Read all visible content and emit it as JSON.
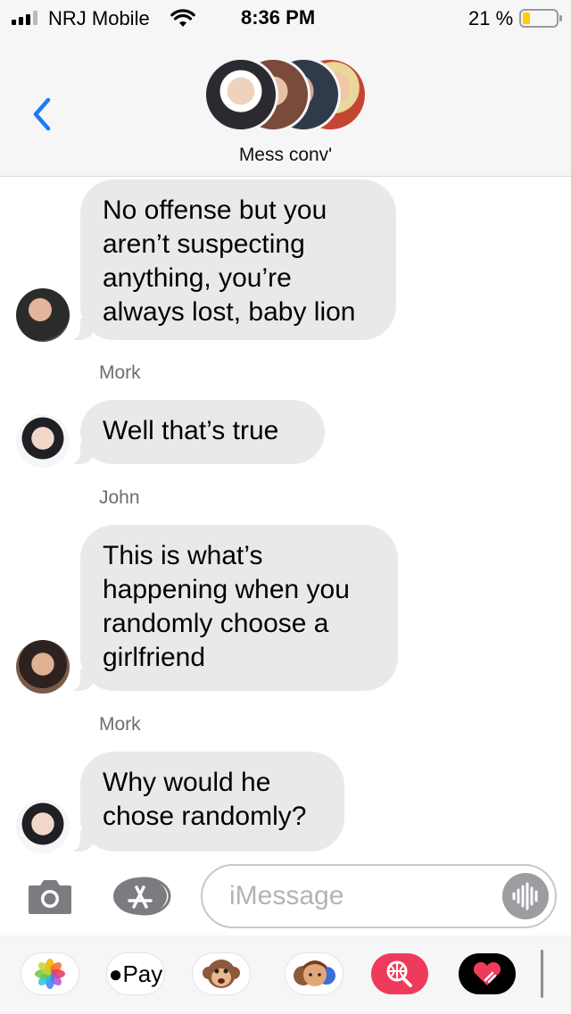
{
  "status_bar": {
    "carrier": "NRJ Mobile",
    "time": "8:36 PM",
    "battery_percent": "21 %",
    "battery_level": 0.21,
    "signal_bars": 3
  },
  "header": {
    "conversation_name": "Mess conv'"
  },
  "messages": [
    {
      "sender": "",
      "text": "No offense but you\naren’t suspecting\nanything, you’re\nalways lost, baby lion"
    },
    {
      "sender": "Mork",
      "text": "Well that’s true"
    },
    {
      "sender": "John",
      "text": "This is what’s\nhappening when you\nrandomly choose a\ngirlfriend"
    },
    {
      "sender": "Mork",
      "text": "Why would he\nchose randomly?"
    }
  ],
  "input": {
    "placeholder": "iMessage"
  },
  "app_drawer": {
    "apple_pay_label": "Pay",
    "apps": [
      "photos-app",
      "apple-pay-app",
      "animoji-app",
      "memoji-app",
      "image-search-app",
      "digital-touch-app"
    ]
  },
  "colors": {
    "accent": "#1a7cf5",
    "bubble_gray": "#e9e9eb",
    "battery_low": "#ffcc00"
  }
}
